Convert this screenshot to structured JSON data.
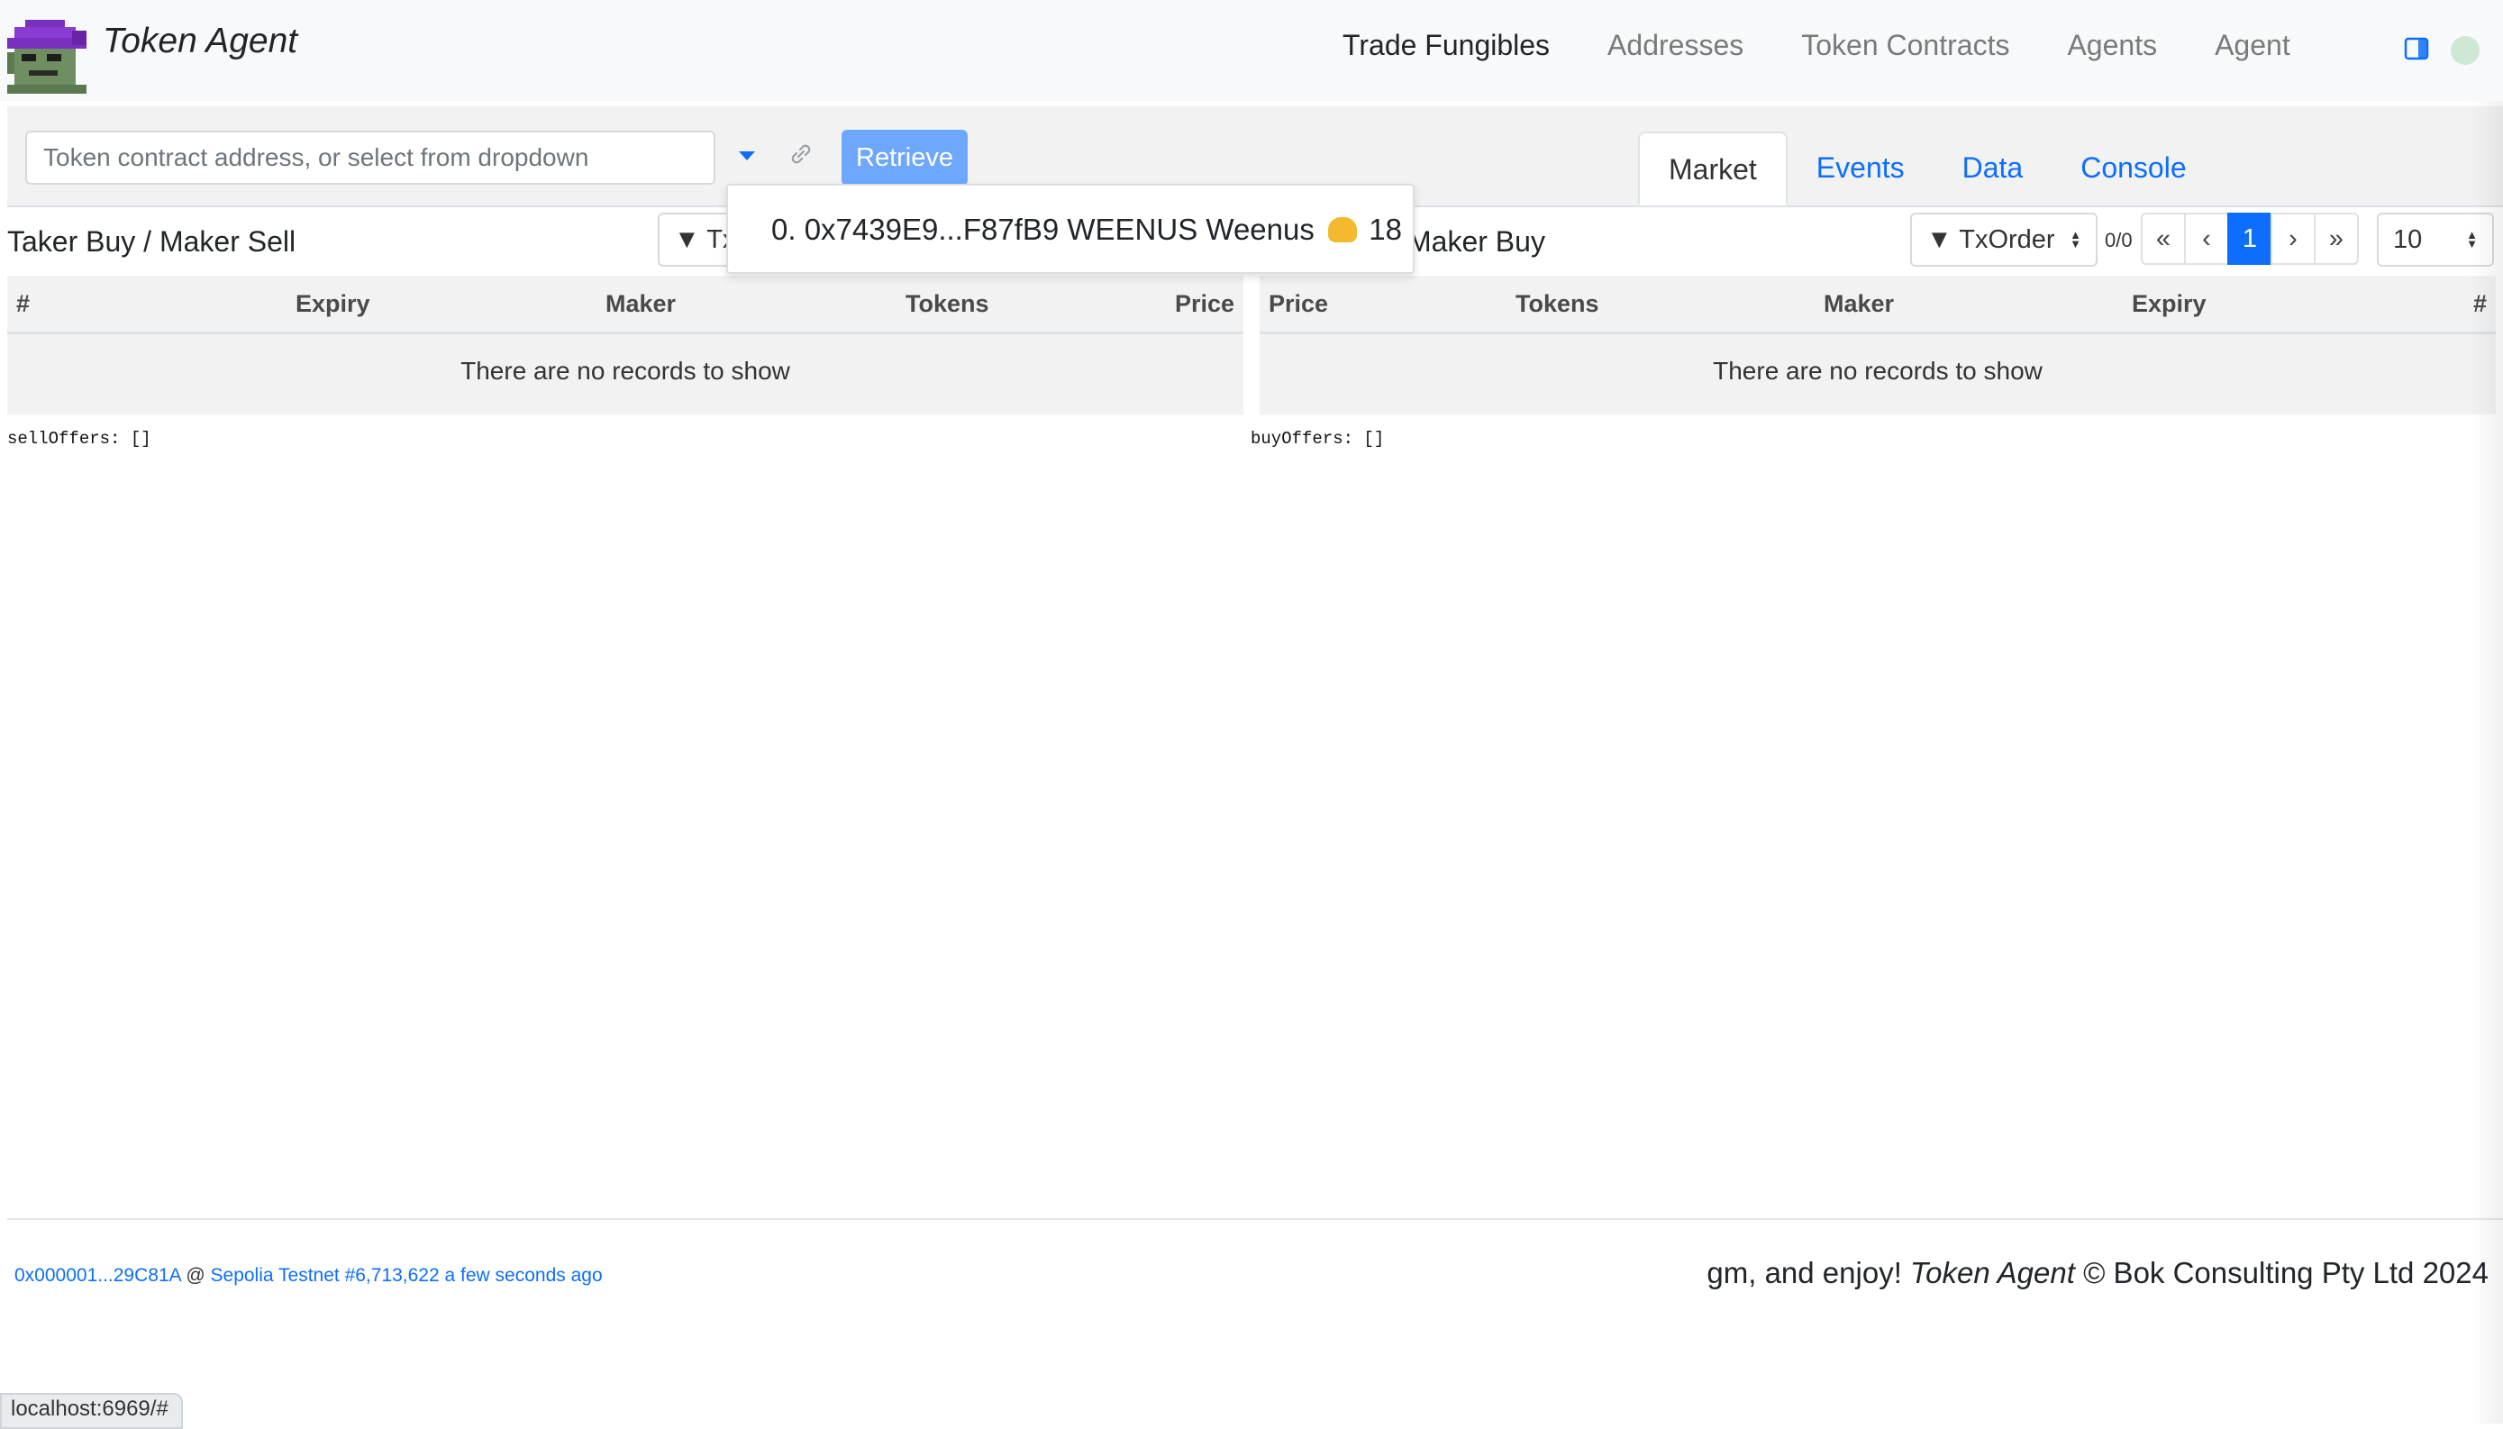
{
  "app": {
    "name": "Token Agent"
  },
  "nav": {
    "items": [
      "Trade Fungibles",
      "Addresses",
      "Token Contracts",
      "Agents",
      "Agent"
    ],
    "active_index": 0
  },
  "toolbar": {
    "token_input": {
      "placeholder": "Token contract address, or select from dropdown",
      "value": ""
    },
    "retrieve_label": "Retrieve"
  },
  "tabs": {
    "items": [
      "Market",
      "Events",
      "Data",
      "Console"
    ],
    "active_index": 0
  },
  "dropdown": {
    "item_text": "0. 0x7439E9...F87fB9 WEENUS Weenus",
    "item_icon": "flexed-biceps-emoji",
    "item_decimals": "18"
  },
  "sell_panel": {
    "title": "Taker Buy / Maker Sell",
    "filter_label": "▼ Tx",
    "columns": [
      "#",
      "Expiry",
      "Maker",
      "Tokens",
      "Price"
    ],
    "empty_text": "There are no records to show",
    "debug": "sellOffers: []"
  },
  "buy_panel": {
    "title": "Maker Buy",
    "filter_label": "▼ TxOrder",
    "count": "0/0",
    "pagination": [
      "«",
      "‹",
      "1",
      "›",
      "»"
    ],
    "active_page": "1",
    "per_page": "10",
    "columns": [
      "Price",
      "Tokens",
      "Maker",
      "Expiry",
      "#"
    ],
    "empty_text": "There are no records to show",
    "debug": "buyOffers: []"
  },
  "footer": {
    "address": "0x000001...29C81A",
    "separator": "@",
    "network": "Sepolia Testnet #6,713,622 a few seconds ago",
    "greeting": "gm, and enjoy!",
    "brand": "Token Agent",
    "copyright": "© Bok Consulting Pty Ltd 2024"
  },
  "status_bar": {
    "url": "localhost:6969/#"
  },
  "colors": {
    "primary": "#0d6efd",
    "primary_light": "#6ea8fe",
    "toolbar_bg": "#f2f2f2",
    "logo_purple": "#7b2fbf",
    "logo_green": "#6f8f63"
  }
}
